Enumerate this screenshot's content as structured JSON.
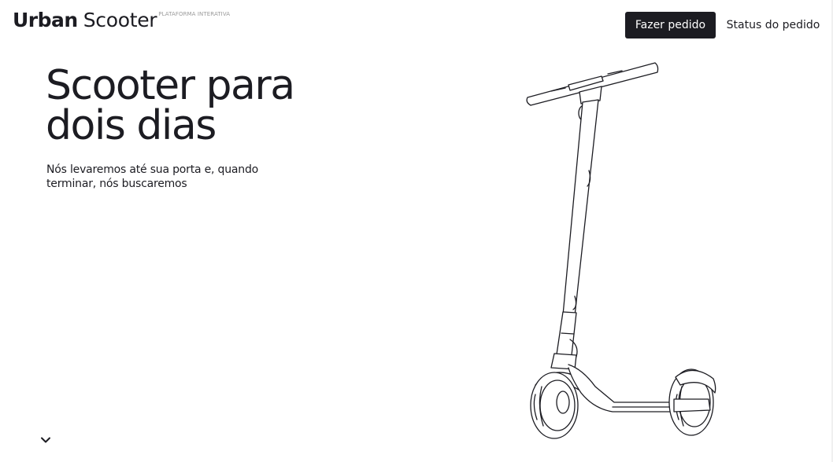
{
  "header": {
    "logo_bold": "Urban",
    "logo_light": "Scooter",
    "logo_sub": "PLATAFORMA INTERATIVA",
    "order_button": "Fazer pedido",
    "status_button": "Status do pedido"
  },
  "hero": {
    "title": "Scooter para dois dias",
    "subtitle": "Nós levaremos até sua porta e, quando terminar, nós buscaremos"
  },
  "icons": {
    "scroll": "chevron-down-icon",
    "illustration": "scooter-illustration"
  },
  "colors": {
    "text": "#1c1c22",
    "button_bg": "#1c1c22",
    "button_text": "#ffffff",
    "background": "#ffffff",
    "logo_sub": "#9a9a9a"
  }
}
